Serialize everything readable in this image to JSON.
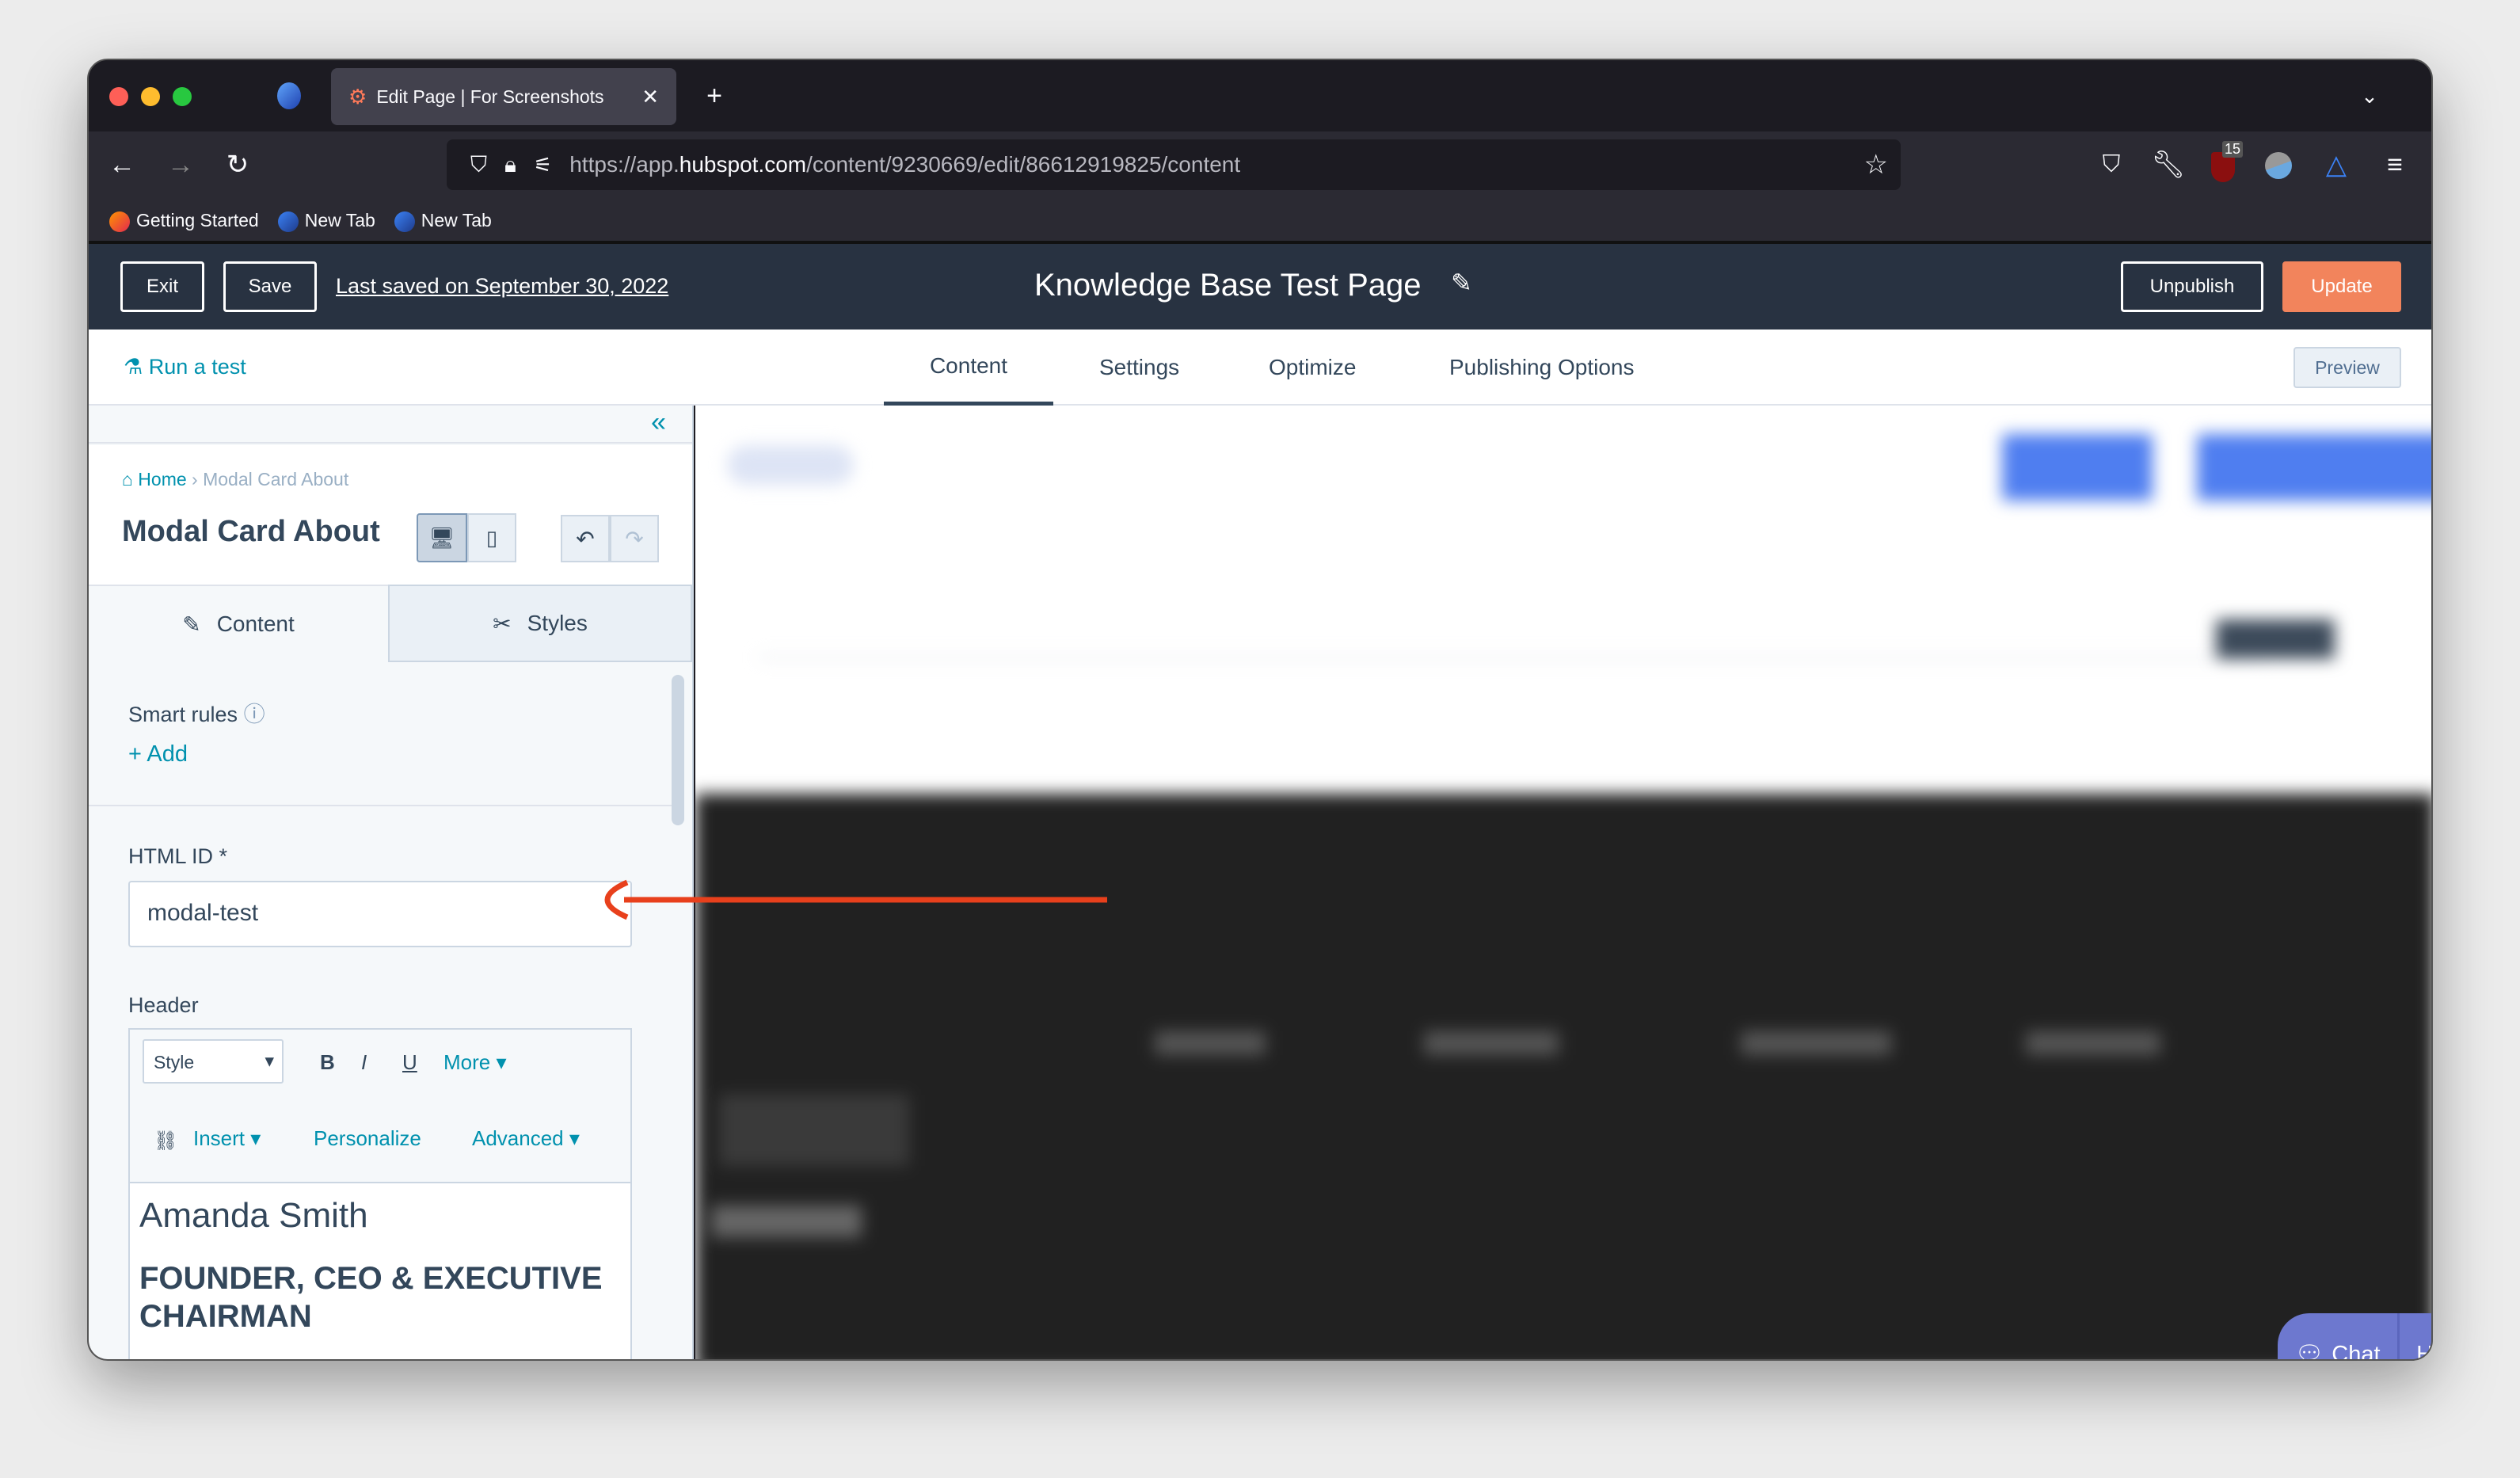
{
  "browser": {
    "tab_title": "Edit Page | For Screenshots",
    "url_host_prefix": "https://app.",
    "url_host": "hubspot.com",
    "url_path": "/content/9230669/edit/86612919825/content",
    "extension_badge": "15",
    "bookmarks": [
      {
        "label": "Getting Started"
      },
      {
        "label": "New Tab"
      },
      {
        "label": "New Tab"
      }
    ]
  },
  "header": {
    "exit_label": "Exit",
    "save_label": "Save",
    "last_saved": "Last saved on September 30, 2022",
    "page_title": "Knowledge Base Test Page",
    "unpublish_label": "Unpublish",
    "update_label": "Update",
    "accent": "#f2845c"
  },
  "subnav": {
    "run_test": "Run a test",
    "tabs": [
      {
        "label": "Content",
        "active": true
      },
      {
        "label": "Settings"
      },
      {
        "label": "Optimize"
      },
      {
        "label": "Publishing Options"
      }
    ],
    "preview_label": "Preview"
  },
  "panel": {
    "breadcrumb_home": "Home",
    "breadcrumb_current": "Modal Card About",
    "title": "Modal Card About",
    "tabs": [
      {
        "label": "Content"
      },
      {
        "label": "Styles"
      }
    ],
    "smart_rules": "Smart rules",
    "add_label": "Add",
    "html_id_label": "HTML ID *",
    "html_id_value": "modal-test",
    "header_label": "Header",
    "toolbar": {
      "style": "Style",
      "bold": "B",
      "italic": "I",
      "underline": "U",
      "more": "More",
      "insert": "Insert",
      "personalize": "Personalize",
      "advanced": "Advanced"
    },
    "editor_name": "Amanda Smith",
    "editor_title": "FOUNDER, CEO & EXECUTIVE CHAIRMAN"
  },
  "chat": {
    "chat_label": "Chat",
    "help_label": "Help",
    "color": "#6d78cf"
  },
  "annotation_color": "#e8401c"
}
